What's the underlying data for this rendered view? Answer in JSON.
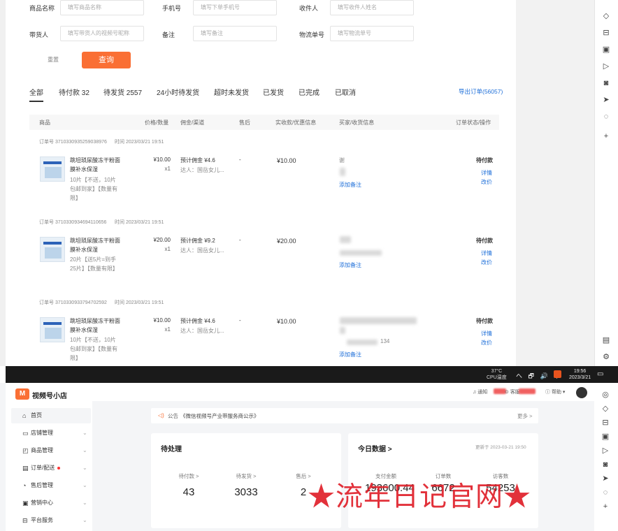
{
  "filters": {
    "product_name": {
      "label": "商品名称",
      "placeholder": "填写商品名称"
    },
    "phone": {
      "label": "手机号",
      "placeholder": "填写下单手机号"
    },
    "receiver": {
      "label": "收件人",
      "placeholder": "填写收件人姓名"
    },
    "promoter": {
      "label": "带货人",
      "placeholder": "填写带货人的视频号昵称"
    },
    "remark": {
      "label": "备注",
      "placeholder": "填写备注"
    },
    "tracking": {
      "label": "物流单号",
      "placeholder": "填写物流单号"
    },
    "reset_label": "重置",
    "query_label": "查询"
  },
  "tabs": [
    {
      "label": "全部"
    },
    {
      "label": "待付款 32"
    },
    {
      "label": "待发货 2557"
    },
    {
      "label": "24小时待发货"
    },
    {
      "label": "超时未发货"
    },
    {
      "label": "已发货"
    },
    {
      "label": "已完成"
    },
    {
      "label": "已取消"
    }
  ],
  "export_label": "导出订单(56057)",
  "columns": [
    "商品",
    "价格/数量",
    "佣金/渠道",
    "售后",
    "实收款/优惠信息",
    "买家/收货信息",
    "订单状态/操作"
  ],
  "orders": [
    {
      "order_no": "订单号 3710330935259038976",
      "time": "时间 2023/03/21 19:51",
      "product_name": "跳坦琐尿酸冻干粉面膜补水保湿",
      "spec": "10片【不送，10片包邮到家】【数量有限】",
      "price": "¥10.00",
      "qty": "x1",
      "commission": "预计佣金 ¥4.6",
      "channel": "达人：国岳女儿...",
      "aftersale": "-",
      "received": "¥10.00",
      "buyer": "谢",
      "add_note": "添加备注",
      "status": "待付款",
      "detail": "详情",
      "modify": "改价"
    },
    {
      "order_no": "订单号 3710330934694110656",
      "time": "时间 2023/03/21 19:51",
      "product_name": "跳坦琐尿酸冻干粉面膜补水保湿",
      "spec": "20片【送5片=到手25片】【数量有限】",
      "price": "¥20.00",
      "qty": "x1",
      "commission": "预计佣金 ¥9.2",
      "channel": "达人：国岳女儿...",
      "aftersale": "-",
      "received": "¥20.00",
      "buyer": "",
      "add_note": "添加备注",
      "status": "待付款",
      "detail": "详情",
      "modify": "改价"
    },
    {
      "order_no": "订单号 3710330933794702592",
      "time": "时间 2023/03/21 19:51",
      "product_name": "跳坦琐尿酸冻干粉面膜补水保湿",
      "spec": "10片【不送，10片包邮到家】【数量有限】",
      "price": "¥10.00",
      "qty": "x1",
      "commission": "预计佣金 ¥4.6",
      "channel": "达人：国岳女儿...",
      "aftersale": "-",
      "received": "¥10.00",
      "buyer": "134",
      "add_note": "添加备注",
      "status": "待付款",
      "detail": "详情",
      "modify": "改价"
    }
  ],
  "taskbar": {
    "temp": "37°C",
    "cpu": "CPU温度",
    "icons": "へ 🗗 🔊 中",
    "time": "19:56",
    "date": "2023/3/21"
  },
  "shop": {
    "logo": "M",
    "name": "视频号小店",
    "nav": [
      {
        "label": "首页",
        "icon": "home-icon",
        "glyph": "⌂"
      },
      {
        "label": "店铺管理",
        "icon": "store-icon",
        "glyph": "▭"
      },
      {
        "label": "商品管理",
        "icon": "bag-icon",
        "glyph": "◰"
      },
      {
        "label": "订单/配送",
        "icon": "order-icon",
        "glyph": "▤"
      },
      {
        "label": "售后管理",
        "icon": "service-icon",
        "glyph": "◔"
      },
      {
        "label": "营销中心",
        "icon": "marketing-icon",
        "glyph": "▣"
      },
      {
        "label": "平台服务",
        "icon": "platform-icon",
        "glyph": "⊟"
      }
    ],
    "header": {
      "notify": "通知",
      "service": "客服",
      "help": "帮助"
    },
    "notice": {
      "label": "公告",
      "text": "《微信视频号产业带服务商公示》",
      "more": "更多 >"
    },
    "pending": {
      "title": "待处理",
      "items": [
        {
          "label": "待付款 >",
          "value": "43"
        },
        {
          "label": "待发货 >",
          "value": "3033"
        },
        {
          "label": "售后 >",
          "value": "2"
        }
      ]
    },
    "today": {
      "title": "今日数据 >",
      "updated": "更新于 2023-03-21 19:50",
      "items": [
        {
          "label": "支付金额",
          "value": "193600.44"
        },
        {
          "label": "订单数",
          "value": "6672"
        },
        {
          "label": "访客数",
          "value": "54253"
        }
      ]
    }
  },
  "watermark": "★流年日记官网★",
  "colors": {
    "accent": "#fa6f34",
    "link": "#1e6fd9",
    "watermark": "#e0202a"
  }
}
